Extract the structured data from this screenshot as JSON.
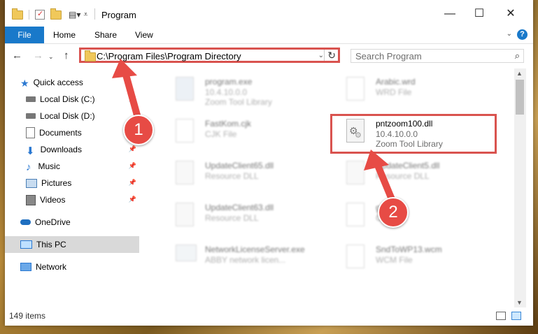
{
  "window": {
    "title": "Program",
    "controls": {
      "minimize": "—",
      "maximize": "☐",
      "close": "✕"
    }
  },
  "ribbon": {
    "tabs": [
      "File",
      "Home",
      "Share",
      "View"
    ],
    "help": "?"
  },
  "address": {
    "path": "C:\\Program Files\\Program Directory",
    "search_placeholder": "Search Program"
  },
  "sidebar": {
    "items": [
      {
        "label": "Quick access",
        "icon": "star-icon",
        "pinned": false
      },
      {
        "label": "Local Disk (C:)",
        "icon": "drive-icon",
        "pinned": true
      },
      {
        "label": "Local Disk (D:)",
        "icon": "drive-icon",
        "pinned": true
      },
      {
        "label": "Documents",
        "icon": "documents-icon",
        "pinned": true
      },
      {
        "label": "Downloads",
        "icon": "download-icon",
        "pinned": true
      },
      {
        "label": "Music",
        "icon": "music-icon",
        "pinned": true
      },
      {
        "label": "Pictures",
        "icon": "pictures-icon",
        "pinned": true
      },
      {
        "label": "Videos",
        "icon": "videos-icon",
        "pinned": true
      },
      {
        "label": "OneDrive",
        "icon": "cloud-icon",
        "pinned": false
      },
      {
        "label": "This PC",
        "icon": "computer-icon",
        "pinned": false
      },
      {
        "label": "Network",
        "icon": "network-icon",
        "pinned": false
      }
    ]
  },
  "files": [
    {
      "name": "program.exe",
      "line1": "10.4.10.0.0",
      "line2": "Zoom Tool Library",
      "blurred": true
    },
    {
      "name": "Arabic.wrd",
      "line1": "WRD File",
      "line2": "",
      "blurred": true
    },
    {
      "name": "FastKom.cjk",
      "line1": "CJK File",
      "line2": "",
      "blurred": true
    },
    {
      "name": "pntzoom100.dll",
      "line1": "10.4.10.0.0",
      "line2": "Zoom Tool Library",
      "blurred": false
    },
    {
      "name": "UpdateClient65.dll",
      "line1": "Resource DLL",
      "line2": "",
      "blurred": true
    },
    {
      "name": "UpdateClient5.dll",
      "line1": "Resource DLL",
      "line2": "",
      "blurred": true
    },
    {
      "name": "UpdateClient63.dll",
      "line1": "Resource DLL",
      "line2": "",
      "blurred": true
    },
    {
      "name": "gfd",
      "line1": "CJK",
      "line2": "",
      "blurred": true
    },
    {
      "name": "NetworkLicenseServer.exe",
      "line1": "ABBY network licen...",
      "line2": "",
      "blurred": true
    },
    {
      "name": "SndToWP13.wcm",
      "line1": "WCM File",
      "line2": "",
      "blurred": true
    }
  ],
  "status": {
    "count": "149 items"
  },
  "annotations": {
    "step1": "1",
    "step2": "2"
  },
  "colors": {
    "accent": "#1979ca",
    "highlight": "#d9534f"
  }
}
